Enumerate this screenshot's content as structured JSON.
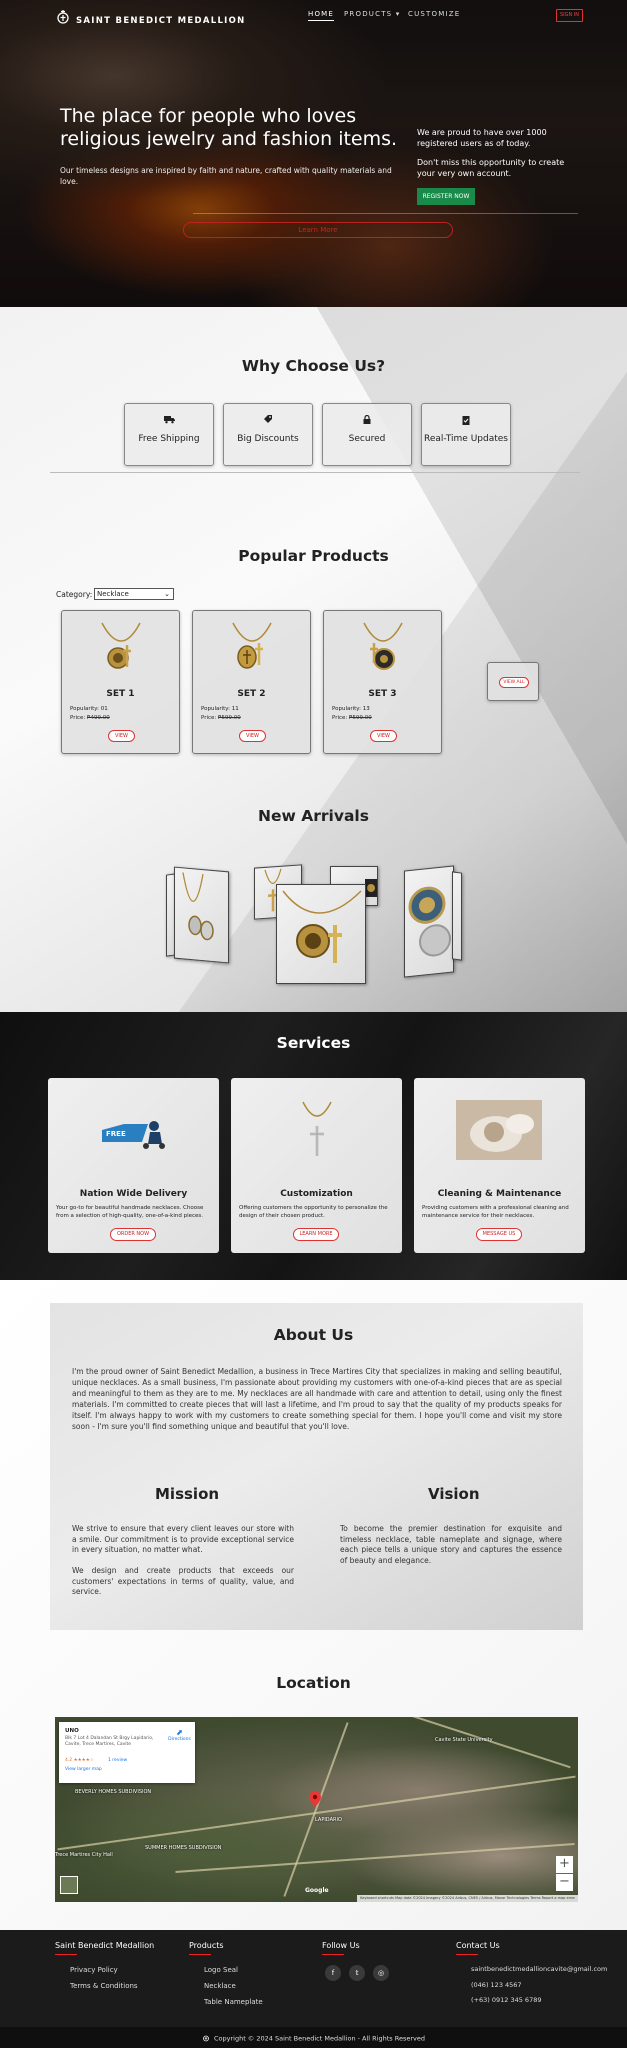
{
  "nav": {
    "brand": "SAINT BENEDICT MEDALLION",
    "home": "HOME",
    "products": "PRODUCTS",
    "customize": "CUSTOMIZE",
    "signin": "SIGN IN"
  },
  "hero": {
    "title": "The place for people who loves religious jewelry and fashion items.",
    "subtitle": "Our timeless designs are inspired by faith and nature, crafted with quality materials and love.",
    "right_text_1": "We are proud to have over 1000 registered users as of today.",
    "right_text_2": "Don't miss this opportunity to create your very own account.",
    "register": "REGISTER NOW",
    "learn_more": "Learn More"
  },
  "why": {
    "title": "Why Choose Us?",
    "features": [
      {
        "label": "Free Shipping",
        "icon": "truck-icon"
      },
      {
        "label": "Big Discounts",
        "icon": "tag-icon"
      },
      {
        "label": "Secured",
        "icon": "lock-icon"
      },
      {
        "label": "Real-Time Updates",
        "icon": "clipboard-check-icon"
      }
    ]
  },
  "popular": {
    "title": "Popular Products",
    "category_label": "Category:",
    "category_value": "Necklace",
    "products": [
      {
        "name": "SET 1",
        "popularity": "Popularity: 01",
        "price_label": "Price:",
        "price": "₱499.00",
        "view": "VIEW"
      },
      {
        "name": "SET 2",
        "popularity": "Popularity: 11",
        "price_label": "Price:",
        "price": "₱599.00",
        "view": "VIEW"
      },
      {
        "name": "SET 3",
        "popularity": "Popularity: 13",
        "price_label": "Price:",
        "price": "₱599.00",
        "view": "VIEW"
      }
    ],
    "view_all": "VIEW ALL"
  },
  "arrivals": {
    "title": "New Arrivals"
  },
  "services": {
    "title": "Services",
    "cards": [
      {
        "name": "Nation Wide Delivery",
        "desc": "Your go-to for beautiful handmade necklaces. Choose from a selection of high-quality, one-of-a-kind pieces.",
        "button": "ORDER NOW"
      },
      {
        "name": "Customization",
        "desc": "Offering customers the opportunity to personalize the design of their chosen product.",
        "button": "LEARN MORE"
      },
      {
        "name": "Cleaning & Maintenance",
        "desc": "Providing customers with a professional cleaning and maintenance service for their necklaces.",
        "button": "MESSAGE US"
      }
    ]
  },
  "about": {
    "title": "About Us",
    "text": "I'm the proud owner of Saint Benedict Medallion, a business in Trece Martires City that specializes in making and selling beautiful, unique necklaces. As a small business, I'm passionate about providing my customers with one-of-a-kind pieces that are as special and meaningful to them as they are to me. My necklaces are all handmade with care and attention to detail, using only the finest materials. I'm committed to create pieces that will last a lifetime, and I'm proud to say that the quality of my products speaks for itself. I'm always happy to work with my customers to create something special for them. I hope you'll come and visit my store soon - I'm sure you'll find something unique and beautiful that you'll love.",
    "mission_title": "Mission",
    "mission_text_1": "We strive to ensure that every client leaves our store with a smile. Our commitment is to provide exceptional service in every situation, no matter what.",
    "mission_text_2": "We design and create products that exceeds our customers' expectations in terms of quality, value, and service.",
    "vision_title": "Vision",
    "vision_text": "To become the premier destination for exquisite and timeless necklace, table nameplate and signage, where each piece tells a unique story and captures the essence of beauty and elegance."
  },
  "location": {
    "title": "Location",
    "place_name": "UNO",
    "address": "Blk 7 Lot 4 Dalandan St Brgy Lapidario, Cavite, Trece Martires, Cavite",
    "directions": "Directions",
    "rating": "4.2 ★★★★☆",
    "reviews": "1 review",
    "larger_map": "View larger map",
    "labels": [
      "BEVERLY HOMES SUBDIVISION",
      "SUMMER HOMES SUBDIVISION",
      "LAPIDARIO",
      "Trece Martires City Hall",
      "Cavite State University"
    ],
    "google": "Google",
    "attribution": "Keyboard shortcuts  Map data ©2024 Imagery ©2024 Airbus, CNES / Airbus, Maxar Technologies  Terms  Report a map error"
  },
  "footer": {
    "col1_title": "Saint Benedict Medallion",
    "col1_links": [
      "Privacy Policy",
      "Terms & Conditions"
    ],
    "col2_title": "Products",
    "col2_links": [
      "Logo Seal",
      "Necklace",
      "Table Nameplate"
    ],
    "col3_title": "Follow Us",
    "col4_title": "Contact Us",
    "email": "saintbenedictmedallioncavite@gmail.com",
    "phone1": "(046) 123 4567",
    "phone2": "(+63) 0912 345 6789",
    "copyright": "Copyright © 2024 Saint Benedict Medallion - All Rights Reserved"
  },
  "colors": {
    "accent": "#dd2222",
    "register": "#1a8a4a",
    "dark": "#1b1b1b"
  }
}
